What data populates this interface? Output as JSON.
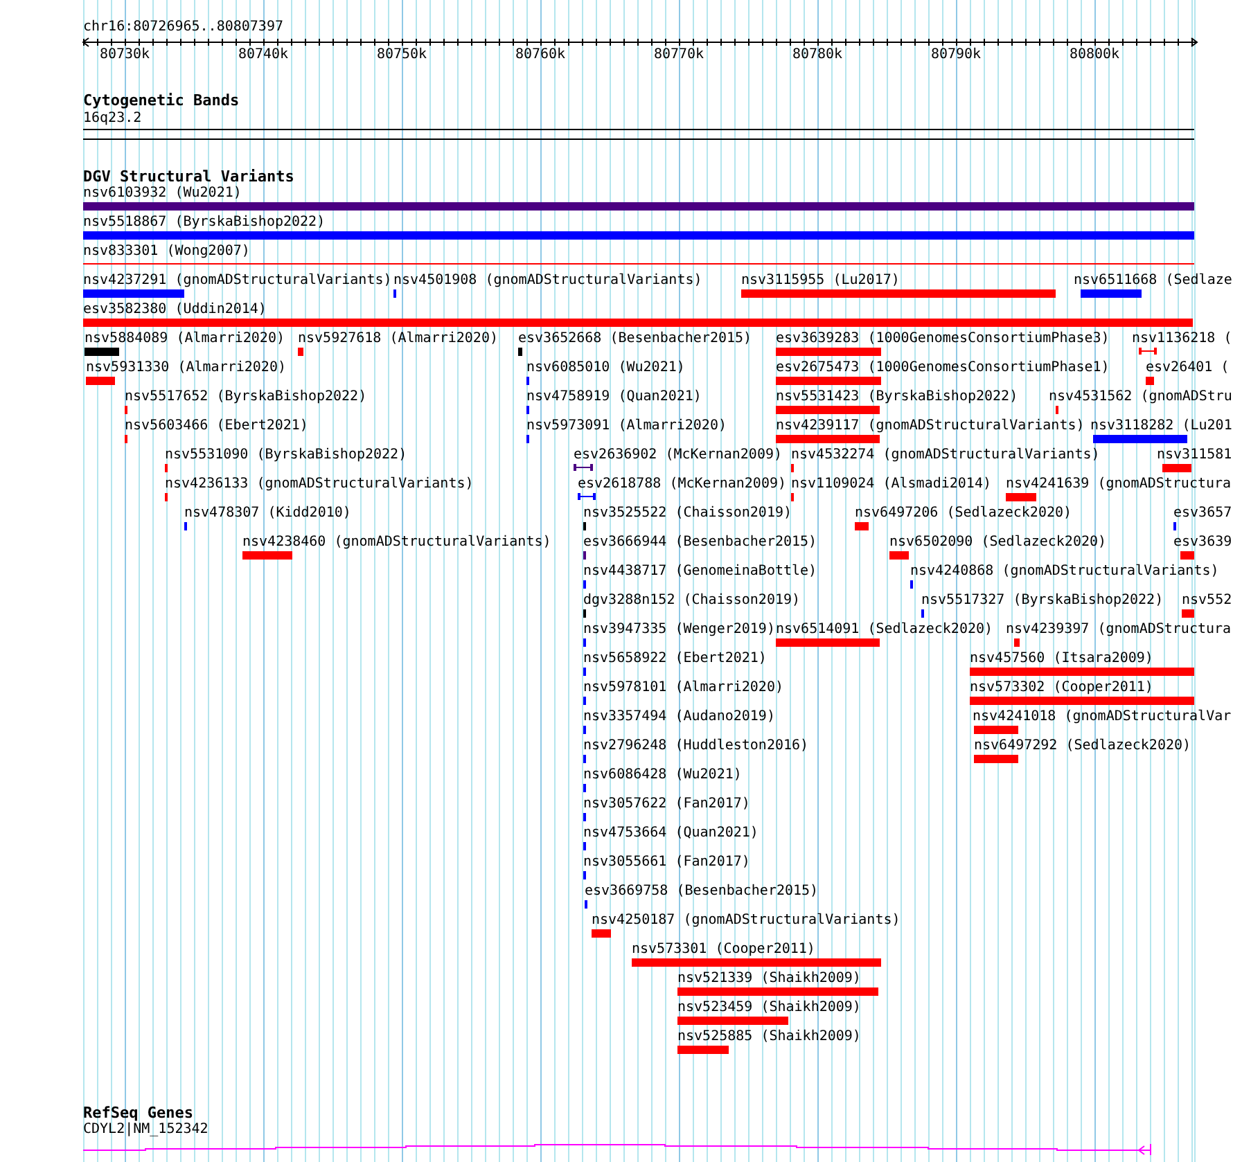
{
  "ruler": {
    "label": "chr16:80726965..80807397",
    "ticks": [
      "80730k",
      "80740k",
      "80750k",
      "80760k",
      "80770k",
      "80780k",
      "80790k",
      "80800k"
    ]
  },
  "tracks": [
    {
      "kind": "cytoband",
      "title": "Cytogenetic Bands",
      "label": "16q23.2"
    },
    {
      "kind": "variants",
      "title": "DGV Structural Variants",
      "rows": [
        [
          {
            "kind": "bar",
            "label": "nsv6103932 (Wu2021)",
            "color": "#4b0082"
          }
        ],
        [
          {
            "kind": "bar",
            "label": "nsv5518867 (ByrskaBishop2022)",
            "color": "#0000ff"
          }
        ],
        [
          {
            "kind": "line",
            "label": "nsv833301 (Wong2007)",
            "color": "#ff0000"
          }
        ],
        [
          {
            "kind": "bar",
            "label": "nsv4237291 (gnomADStructuralVariants)",
            "color": "#0000ff"
          },
          {
            "kind": "bar",
            "label": "nsv4501908 (gnomADStructuralVariants)",
            "color": "#0000ff"
          },
          {
            "kind": "bar",
            "label": "nsv3115955 (Lu2017)",
            "color": "#ff0000"
          },
          {
            "kind": "bar",
            "label": "nsv6511668 (Sedlaze",
            "color": "#0000ff"
          }
        ],
        [
          {
            "kind": "bar",
            "label": "esv3582380 (Uddin2014)",
            "color": "#ff0000"
          }
        ],
        [
          {
            "kind": "bar",
            "label": "nsv5884089 (Almarri2020)",
            "color": "#000000"
          },
          {
            "kind": "bar",
            "label": "nsv5927618 (Almarri2020)",
            "color": "#ff0000"
          },
          {
            "kind": "bar",
            "label": "esv3652668 (Besenbacher2015)",
            "color": "#000000"
          },
          {
            "kind": "bar",
            "label": "esv3639283 (1000GenomesConsortiumPhase3)",
            "color": "#ff0000"
          },
          {
            "kind": "capped",
            "label": "nsv1136218 (",
            "color": "#ff0000"
          }
        ],
        [
          {
            "kind": "bar",
            "label": "nsv5931330 (Almarri2020)",
            "color": "#ff0000"
          },
          {
            "kind": "bar",
            "label": "nsv6085010 (Wu2021)",
            "color": "#0000ff"
          },
          {
            "kind": "bar",
            "label": "esv2675473 (1000GenomesConsortiumPhase1)",
            "color": "#ff0000"
          },
          {
            "kind": "bar",
            "label": "esv26401 (",
            "color": "#ff0000"
          }
        ],
        [
          {
            "kind": "bar",
            "label": "nsv5517652 (ByrskaBishop2022)",
            "color": "#ff0000"
          },
          {
            "kind": "bar",
            "label": "nsv4758919 (Quan2021)",
            "color": "#0000ff"
          },
          {
            "kind": "bar",
            "label": "nsv5531423 (ByrskaBishop2022)",
            "color": "#ff0000"
          },
          {
            "kind": "bar",
            "label": "nsv4531562 (gnomADStru",
            "color": "#ff0000"
          }
        ],
        [
          {
            "kind": "bar",
            "label": "nsv5603466 (Ebert2021)",
            "color": "#ff0000"
          },
          {
            "kind": "bar",
            "label": "nsv5973091 (Almarri2020)",
            "color": "#0000ff"
          },
          {
            "kind": "bar",
            "label": "nsv4239117 (gnomADStructuralVariants)",
            "color": "#ff0000"
          },
          {
            "kind": "bar",
            "label": "nsv3118282 (Lu201",
            "color": "#0000ff"
          }
        ],
        [
          {
            "kind": "bar",
            "label": "nsv5531090 (ByrskaBishop2022)",
            "color": "#ff0000"
          },
          {
            "kind": "capped",
            "label": "esv2636902 (McKernan2009)",
            "color": "#4b0082"
          },
          {
            "kind": "bar",
            "label": "nsv4532274 (gnomADStructuralVariants)",
            "color": "#ff0000"
          },
          {
            "kind": "bar",
            "label": "nsv311581",
            "color": "#ff0000"
          }
        ],
        [
          {
            "kind": "bar",
            "label": "nsv4236133 (gnomADStructuralVariants)",
            "color": "#ff0000"
          },
          {
            "kind": "capped",
            "label": "esv2618788 (McKernan2009)",
            "color": "#0000ff"
          },
          {
            "kind": "bar",
            "label": "nsv1109024 (Alsmadi2014)",
            "color": "#ff0000"
          },
          {
            "kind": "bar",
            "label": "nsv4241639 (gnomADStructura",
            "color": "#ff0000"
          }
        ],
        [
          {
            "kind": "bar",
            "label": "nsv478307 (Kidd2010)",
            "color": "#0000ff"
          },
          {
            "kind": "bar",
            "label": "nsv3525522 (Chaisson2019)",
            "color": "#000000"
          },
          {
            "kind": "bar",
            "label": "nsv6497206 (Sedlazeck2020)",
            "color": "#ff0000"
          },
          {
            "kind": "bar",
            "label": "esv3657",
            "color": "#0000ff"
          }
        ],
        [
          {
            "kind": "bar",
            "label": "nsv4238460 (gnomADStructuralVariants)",
            "color": "#ff0000"
          },
          {
            "kind": "bar",
            "label": "esv3666944 (Besenbacher2015)",
            "color": "#4b0082"
          },
          {
            "kind": "bar",
            "label": "nsv6502090 (Sedlazeck2020)",
            "color": "#ff0000"
          },
          {
            "kind": "bar",
            "label": "esv3639",
            "color": "#ff0000"
          }
        ],
        [
          {
            "kind": "bar",
            "label": "nsv4438717 (GenomeinaBottle)",
            "color": "#0000ff"
          },
          {
            "kind": "bar",
            "label": "nsv4240868 (gnomADStructuralVariants)",
            "color": "#0000ff"
          }
        ],
        [
          {
            "kind": "bar",
            "label": "dgv3288n152 (Chaisson2019)",
            "color": "#000000"
          },
          {
            "kind": "bar",
            "label": "nsv5517327 (ByrskaBishop2022)",
            "color": "#0000ff"
          },
          {
            "kind": "bar",
            "label": "nsv552",
            "color": "#ff0000"
          }
        ],
        [
          {
            "kind": "bar",
            "label": "nsv3947335 (Wenger2019)",
            "color": "#0000ff"
          },
          {
            "kind": "bar",
            "label": "nsv6514091 (Sedlazeck2020)",
            "color": "#ff0000"
          },
          {
            "kind": "bar",
            "label": "nsv4239397 (gnomADStructura",
            "color": "#ff0000"
          }
        ],
        [
          {
            "kind": "bar",
            "label": "nsv5658922 (Ebert2021)",
            "color": "#0000ff"
          },
          {
            "kind": "bar",
            "label": "nsv457560 (Itsara2009)",
            "color": "#ff0000"
          }
        ],
        [
          {
            "kind": "bar",
            "label": "nsv5978101 (Almarri2020)",
            "color": "#0000ff"
          },
          {
            "kind": "bar",
            "label": "nsv573302 (Cooper2011)",
            "color": "#ff0000"
          }
        ],
        [
          {
            "kind": "bar",
            "label": "nsv3357494 (Audano2019)",
            "color": "#0000ff"
          },
          {
            "kind": "bar",
            "label": "nsv4241018 (gnomADStructuralVar",
            "color": "#ff0000"
          }
        ],
        [
          {
            "kind": "bar",
            "label": "nsv2796248 (Huddleston2016)",
            "color": "#0000ff"
          },
          {
            "kind": "bar",
            "label": "nsv6497292 (Sedlazeck2020)",
            "color": "#ff0000"
          }
        ],
        [
          {
            "kind": "bar",
            "label": "nsv6086428 (Wu2021)",
            "color": "#0000ff"
          }
        ],
        [
          {
            "kind": "bar",
            "label": "nsv3057622 (Fan2017)",
            "color": "#0000ff"
          }
        ],
        [
          {
            "kind": "bar",
            "label": "nsv4753664 (Quan2021)",
            "color": "#0000ff"
          }
        ],
        [
          {
            "kind": "bar",
            "label": "nsv3055661 (Fan2017)",
            "color": "#0000ff"
          }
        ],
        [
          {
            "kind": "bar",
            "label": "esv3669758 (Besenbacher2015)",
            "color": "#0000ff"
          }
        ],
        [
          {
            "kind": "bar",
            "label": "nsv4250187 (gnomADStructuralVariants)",
            "color": "#ff0000"
          }
        ],
        [
          {
            "kind": "bar",
            "label": "nsv573301 (Cooper2011)",
            "color": "#ff0000"
          }
        ],
        [
          {
            "kind": "bar",
            "label": "nsv521339 (Shaikh2009)",
            "color": "#ff0000"
          }
        ],
        [
          {
            "kind": "bar",
            "label": "nsv523459 (Shaikh2009)",
            "color": "#ff0000"
          }
        ],
        [
          {
            "kind": "bar",
            "label": "nsv525885 (Shaikh2009)",
            "color": "#ff0000"
          }
        ]
      ]
    },
    {
      "kind": "gene",
      "title": "RefSeq Genes",
      "label": "CDYL2|NM_152342"
    }
  ]
}
